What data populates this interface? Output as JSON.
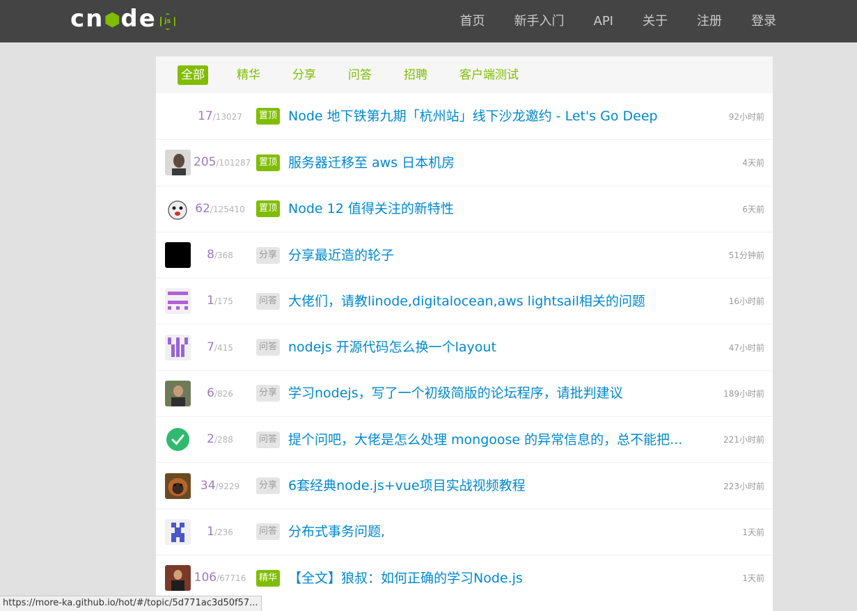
{
  "nav": {
    "logo_text": "cnode",
    "logo_badge": "js",
    "links": [
      "首页",
      "新手入门",
      "API",
      "关于",
      "注册",
      "登录"
    ]
  },
  "tabs": [
    "全部",
    "精华",
    "分享",
    "问答",
    "招聘",
    "客户端测试"
  ],
  "active_tab": "全部",
  "topics": [
    {
      "replies": "17",
      "views": "13027",
      "tag": "置顶",
      "tag_style": "green",
      "title": "Node 地下铁第九期「杭州站」线下沙龙邀约 - Let's Go Deep",
      "time": "92小时前",
      "avatar": "none"
    },
    {
      "replies": "205",
      "views": "101287",
      "tag": "置顶",
      "tag_style": "green",
      "title": "服务器迁移至 aws 日本机房",
      "time": "4天前",
      "avatar": "photo-man"
    },
    {
      "replies": "62",
      "views": "125410",
      "tag": "置顶",
      "tag_style": "green",
      "title": "Node 12 值得关注的新特性",
      "time": "6天前",
      "avatar": "cartoon"
    },
    {
      "replies": "8",
      "views": "368",
      "tag": "分享",
      "tag_style": "gray",
      "title": "分享最近造的轮子",
      "time": "51分钟前",
      "avatar": "black"
    },
    {
      "replies": "1",
      "views": "175",
      "tag": "问答",
      "tag_style": "gray",
      "title": "大佬们，请教linode,digitalocean,aws lightsail相关的问题",
      "time": "16小时前",
      "avatar": "identicon-pink"
    },
    {
      "replies": "7",
      "views": "415",
      "tag": "问答",
      "tag_style": "gray",
      "title": "nodejs 开源代码怎么换一个layout",
      "time": "47小时前",
      "avatar": "identicon-purple"
    },
    {
      "replies": "6",
      "views": "826",
      "tag": "分享",
      "tag_style": "gray",
      "title": "学习nodejs，写了一个初级简版的论坛程序，请批判建议",
      "time": "189小时前",
      "avatar": "photo-person"
    },
    {
      "replies": "2",
      "views": "288",
      "tag": "问答",
      "tag_style": "gray",
      "title": "提个问吧，大佬是怎么处理 mongoose 的异常信息的，总不能把...",
      "time": "221小时前",
      "avatar": "check"
    },
    {
      "replies": "34",
      "views": "9229",
      "tag": "分享",
      "tag_style": "gray",
      "title": "6套经典node.js+vue项目实战视频教程",
      "time": "223小时前",
      "avatar": "orangutan"
    },
    {
      "replies": "1",
      "views": "236",
      "tag": "问答",
      "tag_style": "gray",
      "title": "分布式事务问题,",
      "time": "1天前",
      "avatar": "identicon-blue"
    },
    {
      "replies": "106",
      "views": "67716",
      "tag": "精华",
      "tag_style": "green",
      "title": "【全文】狼叔：如何正确的学习Node.js",
      "time": "1天前",
      "avatar": "photo-speaker"
    }
  ],
  "status_url": "https://more-ka.github.io/hot/#/topic/5d771ac3d50f57..."
}
